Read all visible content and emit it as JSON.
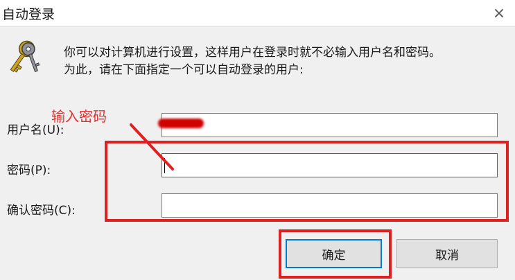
{
  "window": {
    "title": "自动登录",
    "close_icon": "×"
  },
  "description": {
    "line1": "你可以对计算机进行设置，这样用户在登录时就不必输入用户名和密码。",
    "line2": "为此，请在下面指定一个可以自动登录的用户:"
  },
  "fields": {
    "username_label": "用户名(U):",
    "username_value": "",
    "password_label": "密码(P):",
    "password_value": "",
    "confirm_label": "确认密码(C):",
    "confirm_value": ""
  },
  "annotation": {
    "text": "输入密码",
    "color": "#e03030"
  },
  "buttons": {
    "ok": "确定",
    "cancel": "取消"
  },
  "colors": {
    "focus_border": "#0078d7",
    "highlight_red": "#e02020"
  }
}
